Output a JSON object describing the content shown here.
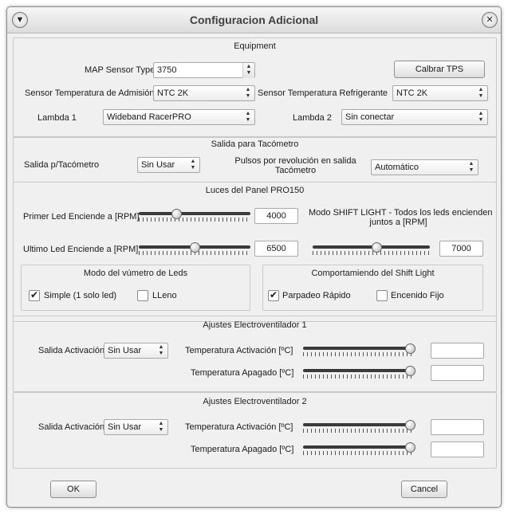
{
  "window": {
    "title": "Configuracion Adicional"
  },
  "equipment": {
    "title": "Equipment",
    "map_label": "MAP Sensor Type",
    "map_value": "3750",
    "calib_button": "Calbrar TPS",
    "temp_adm_label": "Sensor Temperatura de Admisión",
    "temp_adm_value": "NTC 2K",
    "temp_ref_label": "Sensor Temperatura Refrigerante",
    "temp_ref_value": "NTC 2K",
    "lambda1_label": "Lambda 1",
    "lambda1_value": "Wideband RacerPRO",
    "lambda2_label": "Lambda 2",
    "lambda2_value": "Sin conectar"
  },
  "tach": {
    "title": "Salida para Tacómetro",
    "out_label": "Salida p/Tacómetro",
    "out_value": "Sin Usar",
    "pulses_label_line1": "Pulsos por revolución en salida",
    "pulses_label_line2": "Tacómetro",
    "pulses_value": "Automático"
  },
  "panel": {
    "title": "Luces del Panel PRO150",
    "first_led_label": "Primer Led Enciende a [RPM]",
    "first_led_value": "4000",
    "first_led_slider": 0.32,
    "last_led_label": "Ultimo Led Enciende a [RPM]",
    "last_led_value": "6500",
    "last_led_slider": 0.5,
    "shift_label_line1": "Modo SHIFT LIGHT - Todos los leds encienden",
    "shift_label_line2": "juntos a [RPM]",
    "shift_value": "7000",
    "shift_slider": 0.55,
    "vumeter": {
      "title": "Modo del vúmetro de Leds",
      "opt1": "Simple (1 solo led)",
      "opt1_checked": true,
      "opt2": "LLeno",
      "opt2_checked": false
    },
    "shift_behavior": {
      "title": "Comportamiendo del Shift Light",
      "opt1": "Parpadeo Rápido",
      "opt1_checked": true,
      "opt2": "Encenido Fijo",
      "opt2_checked": false
    }
  },
  "fan1": {
    "title": "Ajustes Electroventilador 1",
    "out_label": "Salida Activación",
    "out_value": "Sin Usar",
    "act_label": "Temperatura Activación [ºC]",
    "act_value": "",
    "act_slider": 1.0,
    "off_label": "Temperatura Apagado [ºC]",
    "off_value": "",
    "off_slider": 1.0
  },
  "fan2": {
    "title": "Ajustes Electroventilador 2",
    "out_label": "Salida Activación",
    "out_value": "Sin Usar",
    "act_label": "Temperatura Activación [ºC]",
    "act_value": "",
    "act_slider": 1.0,
    "off_label": "Temperatura Apagado [ºC]",
    "off_value": "",
    "off_slider": 1.0
  },
  "footer": {
    "ok": "OK",
    "cancel": "Cancel"
  },
  "icons": {
    "menu": "chevron-down-icon",
    "close": "close-icon"
  }
}
